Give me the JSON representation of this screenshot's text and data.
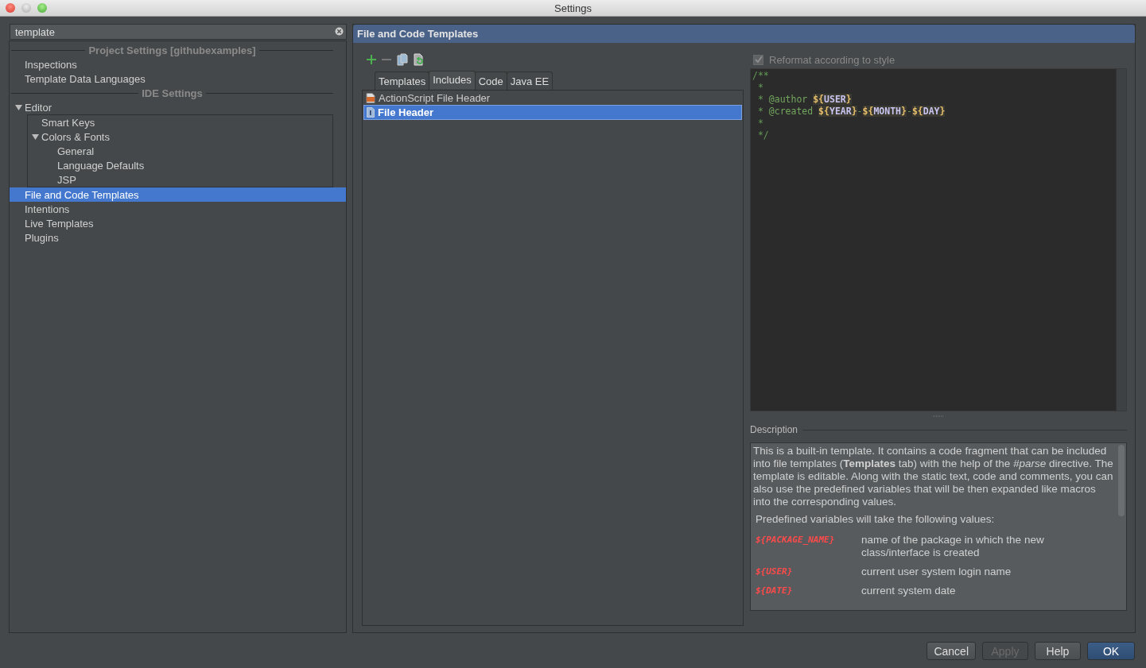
{
  "window": {
    "title": "Settings"
  },
  "search": {
    "value": "template"
  },
  "sidebar": {
    "items": [
      {
        "kind": "header",
        "label": "Project Settings [githubexamples]"
      },
      {
        "kind": "item",
        "label": "Inspections",
        "selected": false
      },
      {
        "kind": "item",
        "label": "Template Data Languages",
        "selected": false
      },
      {
        "kind": "header",
        "label": "IDE Settings"
      },
      {
        "kind": "item",
        "label": "Editor",
        "selected": false,
        "expanded": true,
        "children": [
          {
            "kind": "item",
            "label": "Smart Keys",
            "selected": false
          },
          {
            "kind": "item",
            "label": "Colors & Fonts",
            "selected": false,
            "expanded": true,
            "children": [
              {
                "kind": "item",
                "label": "General",
                "selected": false
              },
              {
                "kind": "item",
                "label": "Language Defaults",
                "selected": false
              },
              {
                "kind": "item",
                "label": "JSP",
                "selected": false
              }
            ]
          }
        ]
      },
      {
        "kind": "item",
        "label": "File and Code Templates",
        "selected": true
      },
      {
        "kind": "item",
        "label": "Intentions",
        "selected": false
      },
      {
        "kind": "item",
        "label": "Live Templates",
        "selected": false
      },
      {
        "kind": "item",
        "label": "Plugins",
        "selected": false
      }
    ]
  },
  "panel": {
    "title": "File and Code Templates",
    "tabs": [
      {
        "label": "Templates",
        "selected": false
      },
      {
        "label": "Includes",
        "selected": true
      },
      {
        "label": "Code",
        "selected": false
      },
      {
        "label": "Java EE",
        "selected": false
      }
    ],
    "templates": [
      {
        "name": "ActionScript File Header",
        "kind": "actionscript",
        "selected": false
      },
      {
        "name": "File Header",
        "kind": "java",
        "selected": true
      }
    ],
    "reformat": {
      "label": "Reformat according to style",
      "checked": true,
      "disabled": true
    },
    "code_lines": [
      [
        {
          "kind": "comment",
          "text": "/**"
        }
      ],
      [
        {
          "kind": "comment",
          "text": " *"
        }
      ],
      [
        {
          "kind": "comment",
          "text": " * "
        },
        {
          "kind": "tag",
          "text": "@author "
        },
        {
          "kind": "dollar",
          "text": "${"
        },
        {
          "kind": "var",
          "text": "USER"
        },
        {
          "kind": "dollar",
          "text": "}"
        }
      ],
      [
        {
          "kind": "comment",
          "text": " * "
        },
        {
          "kind": "tag",
          "text": "@created "
        },
        {
          "kind": "dollar",
          "text": "${"
        },
        {
          "kind": "var",
          "text": "YEAR"
        },
        {
          "kind": "dollar",
          "text": "}"
        },
        {
          "kind": "comment",
          "text": "-"
        },
        {
          "kind": "dollar",
          "text": "${"
        },
        {
          "kind": "var",
          "text": "MONTH"
        },
        {
          "kind": "dollar",
          "text": "}"
        },
        {
          "kind": "comment",
          "text": "-"
        },
        {
          "kind": "dollar",
          "text": "${"
        },
        {
          "kind": "var",
          "text": "DAY"
        },
        {
          "kind": "dollar",
          "text": "}"
        }
      ],
      [
        {
          "kind": "comment",
          "text": " *"
        }
      ],
      [
        {
          "kind": "comment",
          "text": " */"
        }
      ]
    ],
    "description": {
      "label": "Description",
      "text": "This is a built-in template. It contains a code fragment that can be included into file templates (**Templates** tab) with the help of the *#parse* directive. The template is editable. Along with the static text, code and comments, you can also use the predefined variables that will be then expanded like macros into the corresponding values.",
      "intro": "Predefined variables will take the following values:",
      "variables": [
        {
          "name": "${PACKAGE_NAME}",
          "meaning": "name of the package in which the new class/interface is created"
        },
        {
          "name": "${USER}",
          "meaning": "current user system login name"
        },
        {
          "name": "${DATE}",
          "meaning": "current system date"
        }
      ]
    }
  },
  "buttons": [
    {
      "label": "Cancel",
      "kind": "normal",
      "disabled": false
    },
    {
      "label": "Apply",
      "kind": "normal",
      "disabled": true
    },
    {
      "label": "Help",
      "kind": "normal",
      "disabled": false
    },
    {
      "label": "OK",
      "kind": "default",
      "disabled": false
    }
  ]
}
